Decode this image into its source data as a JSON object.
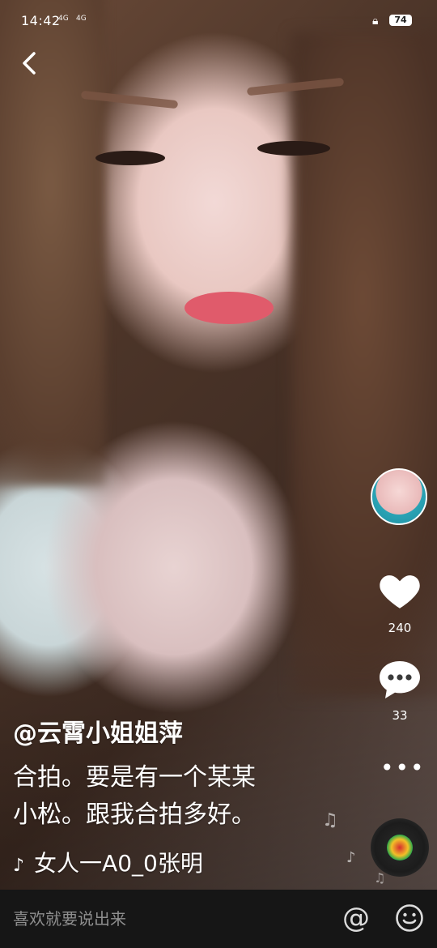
{
  "status_bar": {
    "time": "14:42",
    "signal_1": "4G",
    "signal_2": "4G",
    "battery": "74"
  },
  "author": "@云霄小姐姐萍",
  "caption_lines": [
    "合拍。要是有一个某某",
    "小松。跟我合拍多好。"
  ],
  "music": "女人一A0_0张明",
  "like_count": "240",
  "comment_count": "33",
  "comment_input": {
    "placeholder": "喜欢就要说出来"
  },
  "icons": {
    "back": "chevron-left-icon",
    "like": "heart-icon",
    "comment": "chat-bubble-icon",
    "more": "more-dots-icon",
    "at": "at-icon",
    "emoji": "smiley-icon",
    "note": "music-note-icon"
  },
  "colors": {
    "bottom_bar": "#161616",
    "placeholder": "#8e8e8e"
  }
}
